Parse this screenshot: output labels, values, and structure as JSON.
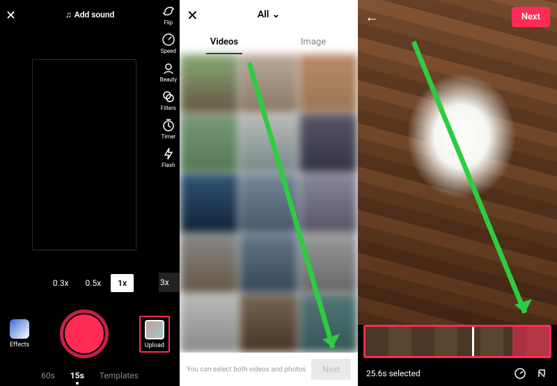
{
  "camera": {
    "close": "✕",
    "add_sound": "Add sound",
    "sideTools": {
      "flip": "Flip",
      "speed": "Speed",
      "beauty": "Beauty",
      "filters": "Filters",
      "timer": "Timer",
      "flash": "Flash"
    },
    "zooms": {
      "z03": "0.3x",
      "z05": "0.5x",
      "z1": "1x",
      "zextra": "3x"
    },
    "effects_label": "Effects",
    "upload_label": "Upload",
    "modes": {
      "m60": "60s",
      "m15": "15s",
      "templates": "Templates"
    }
  },
  "picker": {
    "close": "✕",
    "all": "All",
    "tabs": {
      "videos": "Videos",
      "image": "Image"
    },
    "hint": "You can select both videos and photos",
    "next": "Next"
  },
  "trim": {
    "next": "Next",
    "selected": "25.6s selected"
  }
}
